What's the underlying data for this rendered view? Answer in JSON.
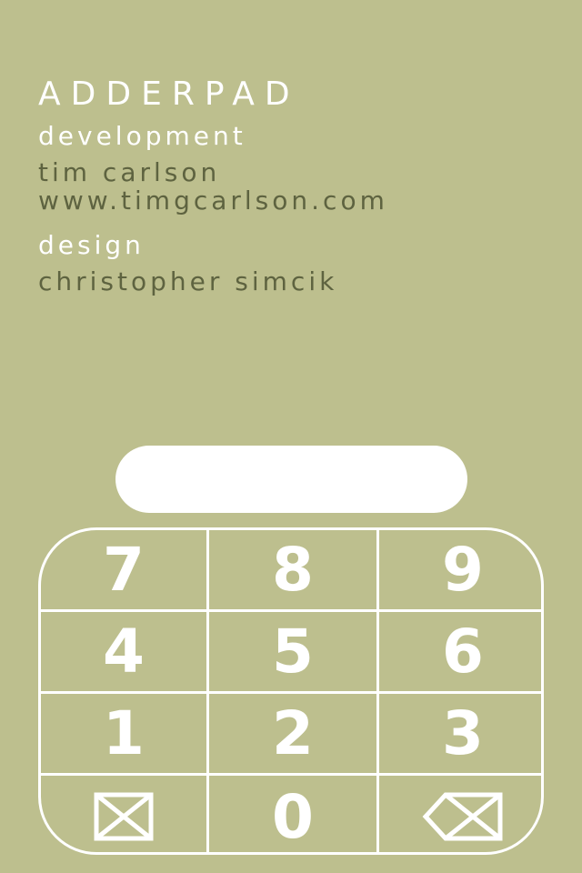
{
  "credits": {
    "app_name": "ADDERPAD",
    "development_heading": "development",
    "developer_name": "tim carlson",
    "developer_url": "www.timgcarlson.com",
    "design_heading": "design",
    "designer_name": "christopher simcik"
  },
  "display": {
    "value": ""
  },
  "keypad": {
    "rows": [
      [
        "7",
        "8",
        "9"
      ],
      [
        "4",
        "5",
        "6"
      ],
      [
        "1",
        "2",
        "3"
      ]
    ],
    "bottom": {
      "left_icon": "clear-box-icon",
      "zero": "0",
      "right_icon": "backspace-icon"
    }
  },
  "colors": {
    "background": "#bdbf8e",
    "accent_white": "#ffffff",
    "dark_text": "#5e6340"
  }
}
